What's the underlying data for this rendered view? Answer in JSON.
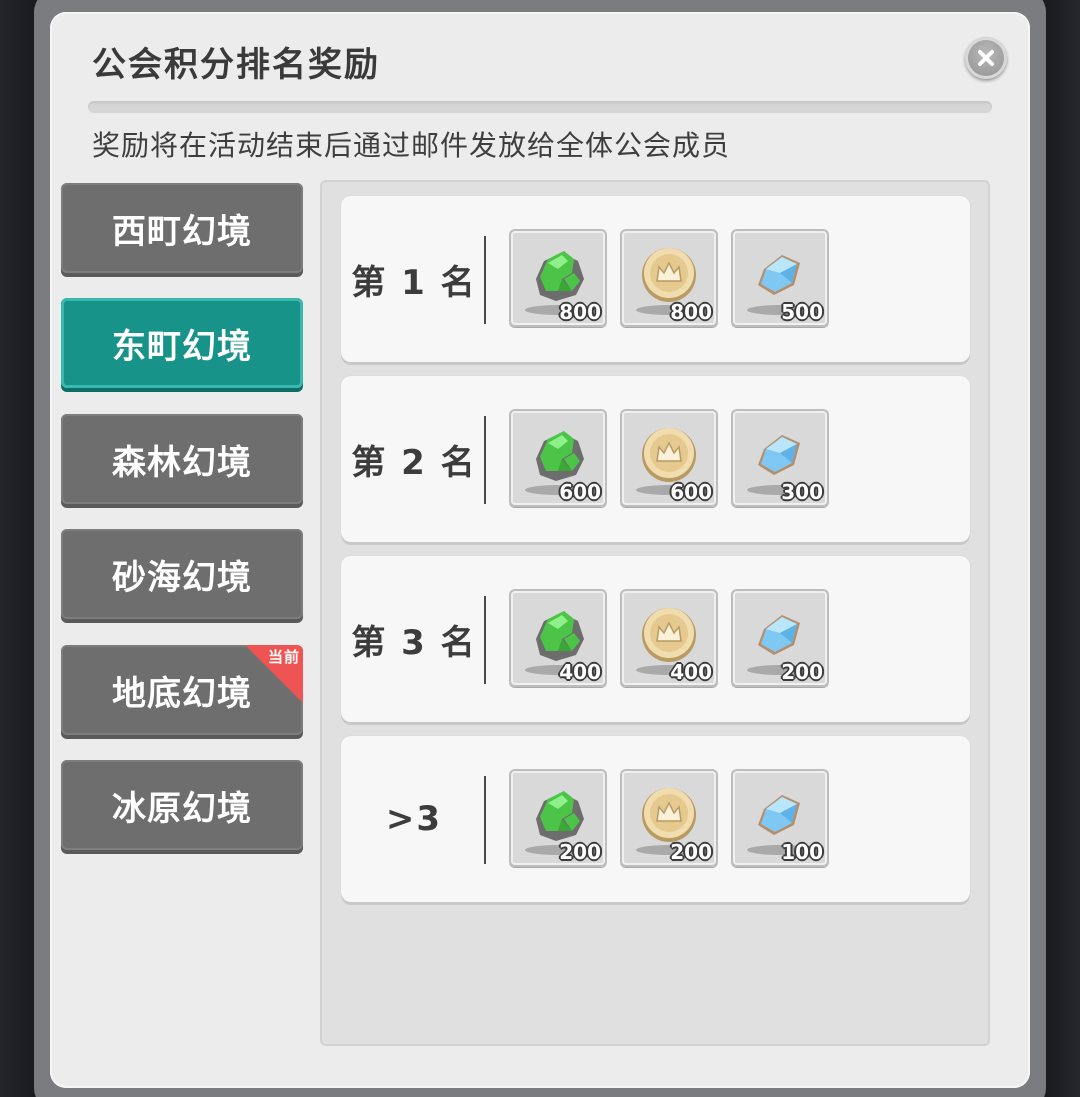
{
  "dialog": {
    "title": "公会积分排名奖励",
    "subtitle": "奖励将在活动结束后通过邮件发放给全体公会成员",
    "close_icon": "close-icon"
  },
  "tabs": [
    {
      "label": "西町幻境",
      "active": false
    },
    {
      "label": "东町幻境",
      "active": true
    },
    {
      "label": "森林幻境",
      "active": false
    },
    {
      "label": "砂海幻境",
      "active": false
    },
    {
      "label": "地底幻境",
      "active": false,
      "badge": "当前"
    },
    {
      "label": "冰原幻境",
      "active": false
    }
  ],
  "reward_items": [
    {
      "name": "green-ore-icon",
      "color": "#5fd35b"
    },
    {
      "name": "gold-coin-icon",
      "color": "#e8c98a"
    },
    {
      "name": "blue-crystal-icon",
      "color": "#7ec8f3"
    }
  ],
  "rows": [
    {
      "rank": "第 1 名",
      "quantities": [
        "800",
        "800",
        "500"
      ]
    },
    {
      "rank": "第 2 名",
      "quantities": [
        "600",
        "600",
        "300"
      ]
    },
    {
      "rank": "第 3 名",
      "quantities": [
        "400",
        "400",
        "200"
      ]
    },
    {
      "rank": ">3",
      "quantities": [
        "200",
        "200",
        "100"
      ]
    }
  ],
  "colors": {
    "active_tab": "#17938a",
    "inactive_tab": "#6e6e6e",
    "badge": "#ef5454"
  }
}
